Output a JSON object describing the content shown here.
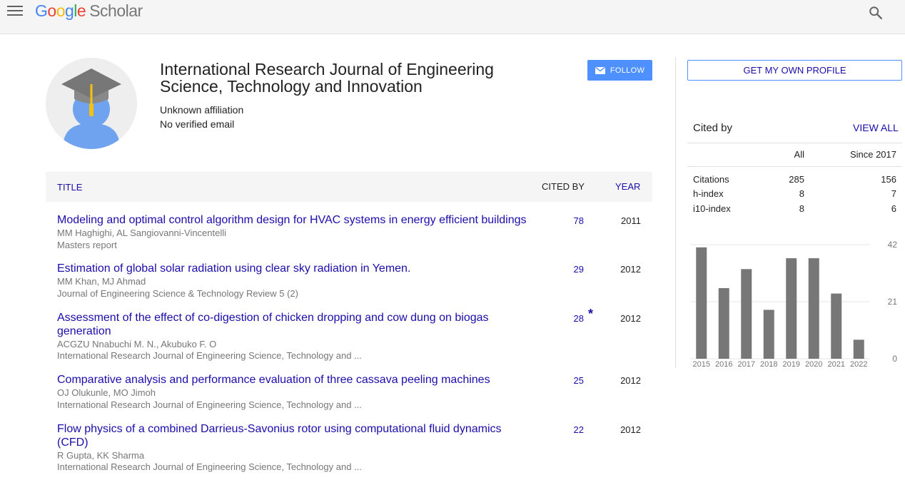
{
  "header": {
    "logo_google": [
      "G",
      "o",
      "o",
      "g",
      "l",
      "e"
    ],
    "logo_scholar": "Scholar"
  },
  "profile": {
    "name": "International Research Journal of Engineering Science, Technology and Innovation",
    "affiliation": "Unknown affiliation",
    "email": "No verified email",
    "follow_label": "FOLLOW"
  },
  "table": {
    "col_title": "TITLE",
    "col_cited": "CITED BY",
    "col_year": "YEAR",
    "rows": [
      {
        "title": "Modeling and optimal control algorithm design for HVAC systems in energy efficient buildings",
        "authors": "MM Haghighi, AL Sangiovanni-Vincentelli",
        "venue": "Masters report",
        "cited": "78",
        "year": "2011",
        "star": ""
      },
      {
        "title": "Estimation of global solar radiation using clear sky radiation in Yemen.",
        "authors": "MM Khan, MJ Ahmad",
        "venue": "Journal of Engineering Science & Technology Review 5 (2)",
        "cited": "29",
        "year": "2012",
        "star": ""
      },
      {
        "title": "Assessment of the effect of co-digestion of chicken dropping and cow dung on biogas generation",
        "authors": "ACGZU Nnabuchi M. N., Akubuko F. O",
        "venue": "International Research Journal of Engineering Science, Technology and ...",
        "cited": "28",
        "year": "2012",
        "star": "*"
      },
      {
        "title": "Comparative analysis and performance evaluation of three cassava peeling machines",
        "authors": "OJ Olukunle, MO Jimoh",
        "venue": "International Research Journal of Engineering Science, Technology and ...",
        "cited": "25",
        "year": "2012",
        "star": ""
      },
      {
        "title": "Flow physics of a combined Darrieus-Savonius rotor using computational fluid dynamics (CFD)",
        "authors": "R Gupta, KK Sharma",
        "venue": "International Research Journal of Engineering Science, Technology and ...",
        "cited": "22",
        "year": "2012",
        "star": ""
      }
    ]
  },
  "sidebar": {
    "get_profile_label": "GET MY OWN PROFILE",
    "cited_by_label": "Cited by",
    "view_all_label": "VIEW ALL",
    "col_all": "All",
    "col_since": "Since 2017",
    "stats": [
      {
        "label": "Citations",
        "all": "285",
        "since": "156"
      },
      {
        "label": "h-index",
        "all": "8",
        "since": "7"
      },
      {
        "label": "i10-index",
        "all": "8",
        "since": "6"
      }
    ]
  },
  "chart_data": {
    "type": "bar",
    "categories": [
      "2015",
      "2016",
      "2017",
      "2018",
      "2019",
      "2020",
      "2021",
      "2022"
    ],
    "values": [
      41,
      26,
      33,
      18,
      37,
      37,
      24,
      7
    ],
    "ylim": [
      0,
      42
    ],
    "yticks": [
      "0",
      "21",
      "42"
    ],
    "bar_color": "#777777",
    "grid": true
  }
}
